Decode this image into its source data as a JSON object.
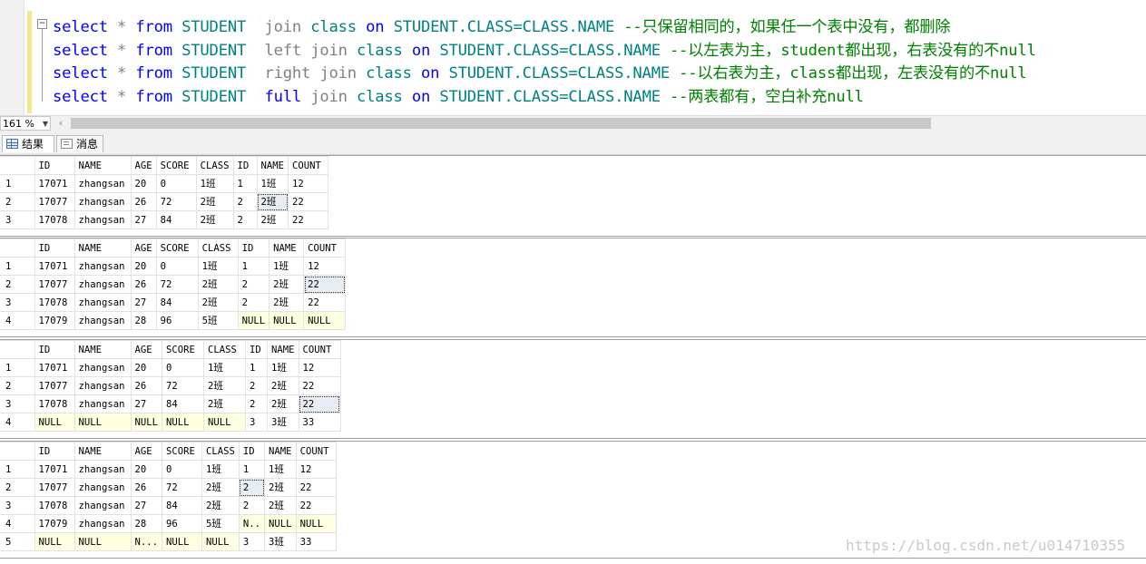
{
  "editor": {
    "lines": [
      {
        "kw1": "select",
        "op": "*",
        "kw2": "from",
        "tbl": "STUDENT",
        "mid": "join",
        "kw3": "class",
        "on": "on",
        "cond": "STUDENT.CLASS=CLASS.NAME",
        "comment": "--只保留相同的，如果任一个表中没有，都删除",
        "join_color": "gray"
      },
      {
        "kw1": "select",
        "op": "*",
        "kw2": "from",
        "tbl": "STUDENT",
        "mid": "left join",
        "kw3": "class",
        "on": "on",
        "cond": "STUDENT.CLASS=CLASS.NAME",
        "comment": "--以左表为主，student都出现，右表没有的不null",
        "join_color": "gray"
      },
      {
        "kw1": "select",
        "op": "*",
        "kw2": "from",
        "tbl": "STUDENT",
        "mid": "right join",
        "kw3": "class",
        "on": "on",
        "cond": "STUDENT.CLASS=CLASS.NAME",
        "comment": "--以右表为主，class都出现，左表没有的不null",
        "join_color": "gray"
      },
      {
        "kw1": "select",
        "op": "*",
        "kw2": "from",
        "tbl": "STUDENT",
        "mid_kw": "full",
        "mid": "join",
        "kw3": "class",
        "on": "on",
        "cond": "STUDENT.CLASS=CLASS.NAME",
        "comment": "--两表都有，空白补充null",
        "join_color": "gray"
      }
    ]
  },
  "zoom": {
    "value": "161 %"
  },
  "tabs": {
    "results": "结果",
    "messages": "消息"
  },
  "columns": [
    "ID",
    "NAME",
    "AGE",
    "SCORE",
    "CLASS",
    "ID",
    "NAME",
    "COUNT"
  ],
  "results": [
    {
      "rows": [
        [
          "1",
          "17071",
          "zhangsan",
          "20",
          "0",
          "1班",
          "1",
          "1班",
          "12"
        ],
        [
          "2",
          "17077",
          "zhangsan",
          "26",
          "72",
          "2班",
          "2",
          "2班",
          "22"
        ],
        [
          "3",
          "17078",
          "zhangsan",
          "27",
          "84",
          "2班",
          "2",
          "2班",
          "22"
        ]
      ]
    },
    {
      "rows": [
        [
          "1",
          "17071",
          "zhangsan",
          "20",
          "0",
          "1班",
          "1",
          "1班",
          "12"
        ],
        [
          "2",
          "17077",
          "zhangsan",
          "26",
          "72",
          "2班",
          "2",
          "2班",
          "22"
        ],
        [
          "3",
          "17078",
          "zhangsan",
          "27",
          "84",
          "2班",
          "2",
          "2班",
          "22"
        ],
        [
          "4",
          "17079",
          "zhangsan",
          "28",
          "96",
          "5班",
          "NULL",
          "NULL",
          "NULL"
        ]
      ]
    },
    {
      "rows": [
        [
          "1",
          "17071",
          "zhangsan",
          "20",
          "0",
          "1班",
          "1",
          "1班",
          "12"
        ],
        [
          "2",
          "17077",
          "zhangsan",
          "26",
          "72",
          "2班",
          "2",
          "2班",
          "22"
        ],
        [
          "3",
          "17078",
          "zhangsan",
          "27",
          "84",
          "2班",
          "2",
          "2班",
          "22"
        ],
        [
          "4",
          "NULL",
          "NULL",
          "NULL",
          "NULL",
          "NULL",
          "3",
          "3班",
          "33"
        ]
      ]
    },
    {
      "rows": [
        [
          "1",
          "17071",
          "zhangsan",
          "20",
          "0",
          "1班",
          "1",
          "1班",
          "12"
        ],
        [
          "2",
          "17077",
          "zhangsan",
          "26",
          "72",
          "2班",
          "2",
          "2班",
          "22"
        ],
        [
          "3",
          "17078",
          "zhangsan",
          "27",
          "84",
          "2班",
          "2",
          "2班",
          "22"
        ],
        [
          "4",
          "17079",
          "zhangsan",
          "28",
          "96",
          "5班",
          "N..",
          "NULL",
          "NULL"
        ],
        [
          "5",
          "NULL",
          "NULL",
          "N...",
          "NULL",
          "NULL",
          "3",
          "3班",
          "33"
        ]
      ]
    }
  ],
  "watermark": "https://blog.csdn.net/u014710355"
}
